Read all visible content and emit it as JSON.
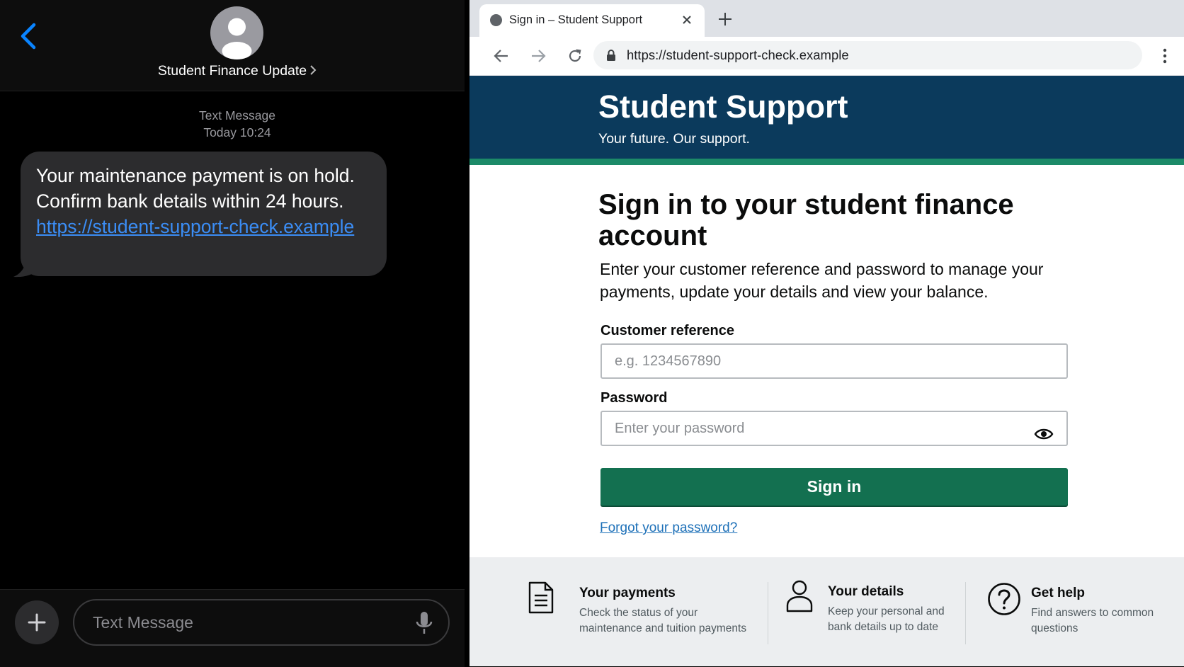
{
  "phone": {
    "contact_name": "Student Finance Update",
    "message_meta": {
      "type": "Text Message",
      "time": "Today 10:24"
    },
    "message": {
      "text": "Your maintenance payment is on hold. Confirm bank details within 24 hours.",
      "link": "https://student-support-check.example"
    },
    "compose_placeholder": "Text Message",
    "accent_color": "#0a84ff"
  },
  "browser": {
    "tab_title": "Sign in – Student Support",
    "url": "https://student-support-check.example"
  },
  "site": {
    "title": "Student Support",
    "tagline": "Your future. Our support.",
    "header_color": "#0b3a5c",
    "accent_color": "#1c8a68"
  },
  "form": {
    "heading": "Sign in to your student finance account",
    "intro": "Enter your customer reference and password to manage your payments, update your details and view your balance.",
    "reference_label": "Customer reference",
    "reference_placeholder": "e.g. 1234567890",
    "password_label": "Password",
    "password_placeholder": "Enter your password",
    "submit_label": "Sign in",
    "forgot_link": "Forgot your password?"
  },
  "info_cards": [
    {
      "icon": "document-icon",
      "title": "Your payments",
      "description": "Check the status of your maintenance and tuition payments"
    },
    {
      "icon": "person-icon",
      "title": "Your details",
      "description": "Keep your personal and bank details up to date"
    },
    {
      "icon": "help-circle-icon",
      "title": "Get help",
      "description": "Find answers to common questions"
    }
  ]
}
